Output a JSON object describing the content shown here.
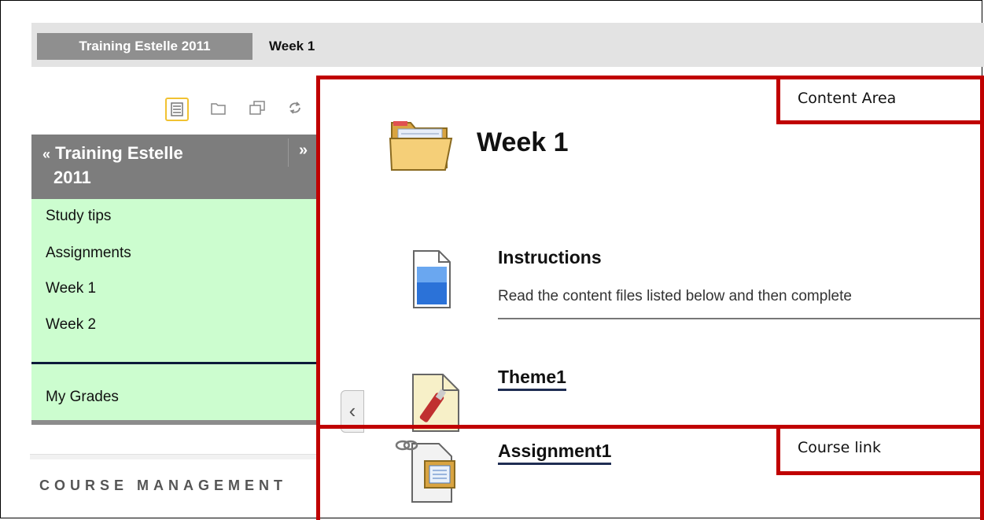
{
  "breadcrumb": {
    "course": "Training Estelle 2011",
    "current": "Week 1"
  },
  "toolbar": {
    "icons": [
      "list-view-icon",
      "folder-view-icon",
      "window-icon",
      "refresh-icon"
    ]
  },
  "course_menu": {
    "title_line1": "Training Estelle",
    "title_line2": "2011",
    "collapse_glyph": "«",
    "expand_glyph": "»",
    "items": [
      "Study tips",
      "Assignments",
      "Week 1",
      "Week 2"
    ],
    "grades": "My Grades"
  },
  "course_management": "COURSE MANAGEMENT",
  "collapse_tab_glyph": "‹",
  "content": {
    "title": "Week 1",
    "items": [
      {
        "title": "Instructions",
        "description": "Read the content files listed below and then complete"
      },
      {
        "title": "Theme1"
      },
      {
        "title": "Assignment1"
      }
    ]
  },
  "annotations": {
    "content_area": "Content Area",
    "course_link": "Course link"
  },
  "colors": {
    "annotation_red": "#c00000",
    "menu_green": "#ccfdcf",
    "menu_gray": "#7d7d7d"
  }
}
